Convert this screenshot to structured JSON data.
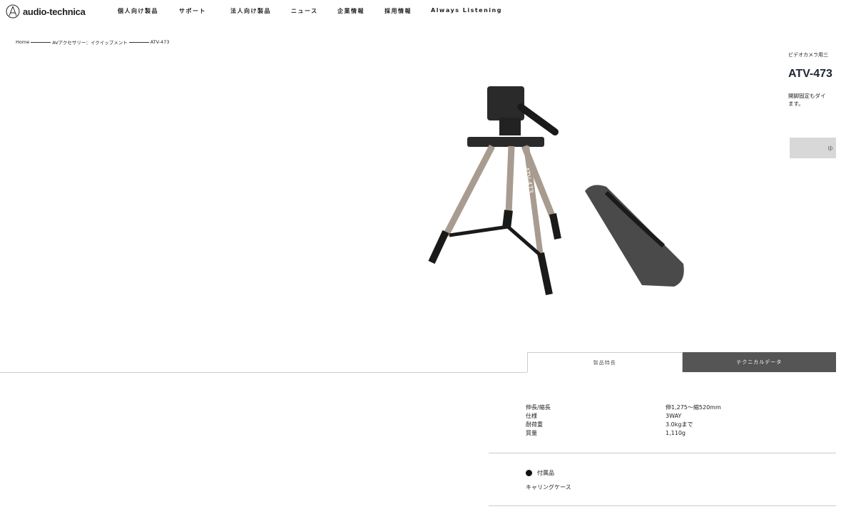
{
  "header": {
    "brand": "audio-technica",
    "nav": [
      "個人向け製品",
      "サポート",
      "法人向け製品",
      "ニュース",
      "企業情報",
      "採用情報",
      "Always Listening"
    ]
  },
  "breadcrumb": [
    "Home",
    "AVアクセサリー：イクイップメント",
    "ATV-473"
  ],
  "product": {
    "subtitle": "ビデオカメラ用三",
    "model": "ATV-473",
    "description": [
      "開脚固定もダイ",
      "ます。"
    ],
    "button_label": "ゆ",
    "image_label": "ATV-473"
  },
  "tabs": [
    "製品特長",
    "テクニカルデータ"
  ],
  "specs": [
    {
      "k": "伸長/縮長",
      "v": "伸1,275～縮520mm"
    },
    {
      "k": "仕様",
      "v": "3WAY"
    },
    {
      "k": "耐荷重",
      "v": "3.0kgまで"
    },
    {
      "k": "質量",
      "v": "1,110g"
    }
  ],
  "accessories": {
    "title": "付属品",
    "items": [
      "キャリングケース"
    ]
  }
}
